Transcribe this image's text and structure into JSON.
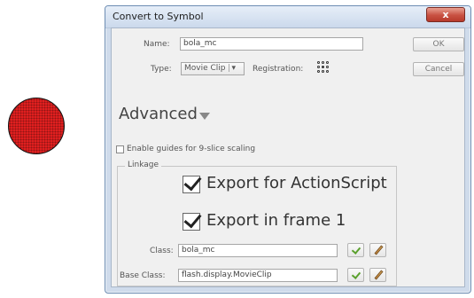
{
  "dialog": {
    "title": "Convert to Symbol",
    "close_label": "x"
  },
  "form": {
    "name_label": "Name:",
    "name_value": "bola_mc",
    "type_label": "Type:",
    "type_value": "Movie Clip",
    "registration_label": "Registration:"
  },
  "buttons": {
    "ok": "OK",
    "cancel": "Cancel"
  },
  "advanced": {
    "label": "Advanced"
  },
  "options": {
    "nine_slice_label": "Enable guides for 9-slice scaling",
    "nine_slice_checked": false
  },
  "linkage": {
    "title": "Linkage",
    "export_actionscript_label": "Export for ActionScript",
    "export_actionscript_checked": true,
    "export_frame1_label": "Export in frame 1",
    "export_frame1_checked": true,
    "class_label": "Class:",
    "class_value": "bola_mc",
    "base_class_label": "Base Class:",
    "base_class_value": "flash.display.MovieClip"
  },
  "colors": {
    "ball": "#e01f1f",
    "title_bar": "#cbd9ec",
    "close_button": "#c85142",
    "check_green": "#5aa02c"
  },
  "icons": {
    "close": "close-icon",
    "dropdown": "chevron-down-icon",
    "registration": "registration-grid-icon",
    "validate": "checkmark-icon",
    "edit": "pencil-icon",
    "advanced_toggle": "triangle-down-icon"
  }
}
